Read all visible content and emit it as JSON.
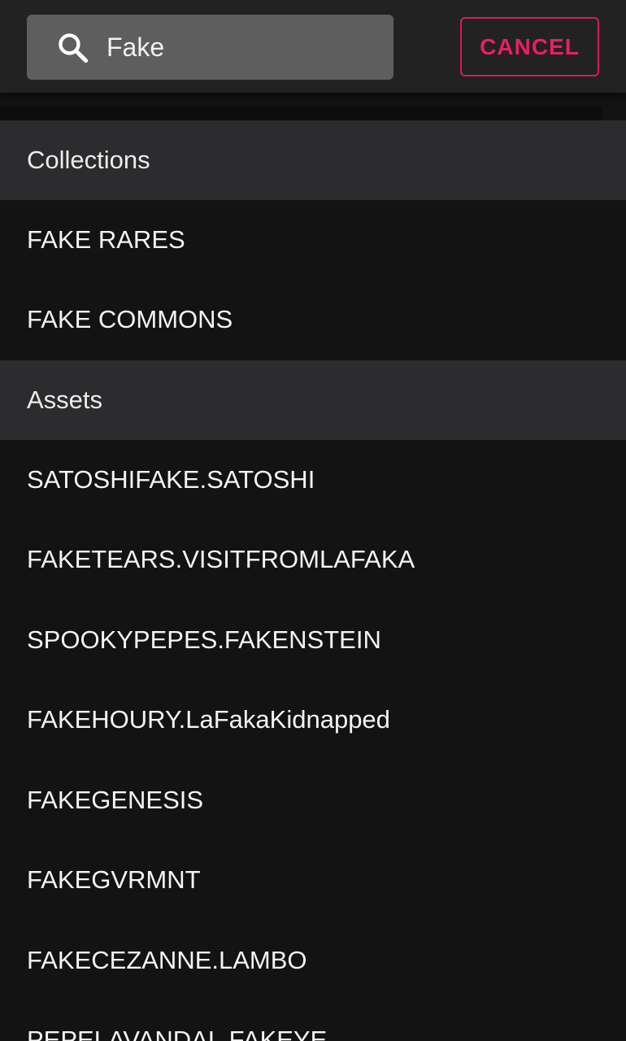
{
  "search": {
    "query": "Fake",
    "icon": "search-icon"
  },
  "toolbar": {
    "cancel_label": "CANCEL",
    "accent_color": "#e91e63"
  },
  "sections": {
    "collections": {
      "title": "Collections",
      "items": [
        "FAKE RARES",
        "FAKE COMMONS"
      ]
    },
    "assets": {
      "title": "Assets",
      "items": [
        "SATOSHIFAKE.SATOSHI",
        "FAKETEARS.VISITFROMLAFAKA",
        "SPOOKYPEPES.FAKENSTEIN",
        "FAKEHOURY.LaFakaKidnapped",
        "FAKEGENESIS",
        "FAKEGVRMNT",
        "FAKECEZANNE.LAMBO",
        "PEPELAVANDAL.FAKEYE"
      ]
    }
  }
}
